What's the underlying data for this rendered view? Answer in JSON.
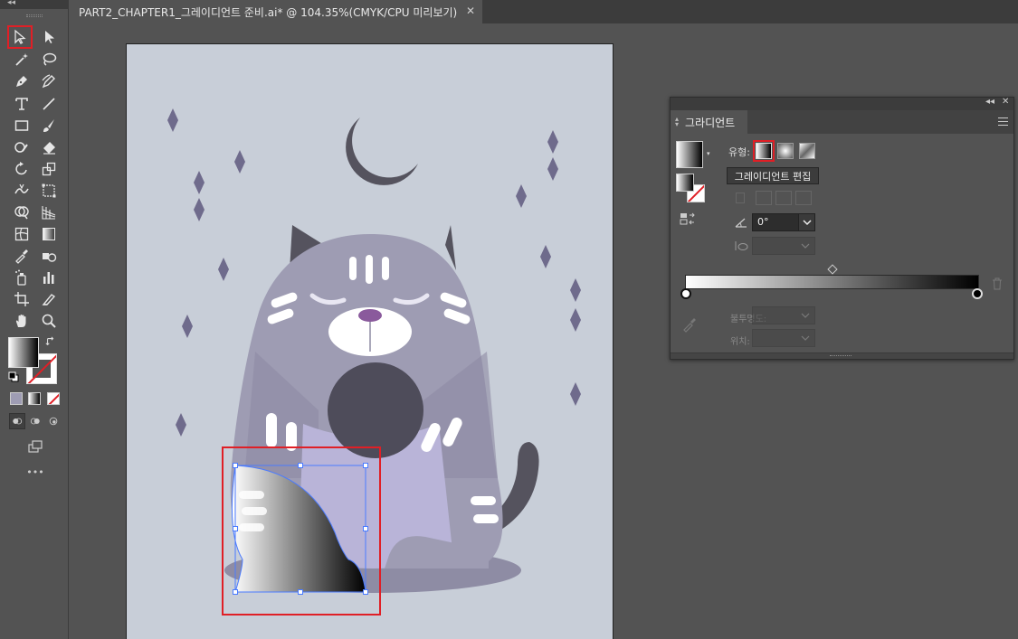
{
  "toolbar": {
    "collapse_glyph": "◂◂",
    "tools": [
      {
        "name": "selection-tool-icon",
        "selected": true
      },
      {
        "name": "direct-selection-tool-icon"
      },
      {
        "name": "magic-wand-tool-icon"
      },
      {
        "name": "lasso-tool-icon"
      },
      {
        "name": "pen-tool-icon"
      },
      {
        "name": "curvature-tool-icon"
      },
      {
        "name": "type-tool-icon"
      },
      {
        "name": "line-segment-tool-icon"
      },
      {
        "name": "rectangle-tool-icon"
      },
      {
        "name": "paintbrush-tool-icon"
      },
      {
        "name": "shaper-tool-icon"
      },
      {
        "name": "eraser-tool-icon"
      },
      {
        "name": "rotate-tool-icon"
      },
      {
        "name": "scale-tool-icon"
      },
      {
        "name": "width-tool-icon"
      },
      {
        "name": "free-transform-tool-icon"
      },
      {
        "name": "shape-builder-tool-icon"
      },
      {
        "name": "perspective-grid-tool-icon"
      },
      {
        "name": "mesh-tool-icon"
      },
      {
        "name": "gradient-tool-icon"
      },
      {
        "name": "eyedropper-tool-icon"
      },
      {
        "name": "blend-tool-icon"
      },
      {
        "name": "symbol-sprayer-tool-icon"
      },
      {
        "name": "column-graph-tool-icon"
      },
      {
        "name": "artboard-tool-icon"
      },
      {
        "name": "slice-tool-icon"
      },
      {
        "name": "hand-tool-icon"
      },
      {
        "name": "zoom-tool-icon"
      }
    ],
    "more_label": "•••"
  },
  "document_tab": {
    "title": "PART2_CHAPTER1_그레이디언트 준비.ai* @ 104.35%(CMYK/CPU 미리보기)",
    "close_glyph": "✕"
  },
  "gradient_panel": {
    "header_collapse": "◂◂",
    "header_close": "✕",
    "tab_label": "그라디언트",
    "type_label": "유형:",
    "tooltip": "그레이디언트 편집",
    "angle_value": "0°",
    "opacity_label": "불투명도:",
    "location_label": "위치:",
    "gradient_start_color": "#ffffff",
    "gradient_end_color": "#000000"
  },
  "artwork": {
    "background_color": "#c8ced8",
    "diamond_color": "#6f6b8c",
    "moon_color": "#55535e",
    "cat_body_color": "#9e9cb3",
    "cat_belly_color": "#b9b4d8",
    "selection_color": "#4a7bff",
    "highlight_color": "#e01f26"
  }
}
